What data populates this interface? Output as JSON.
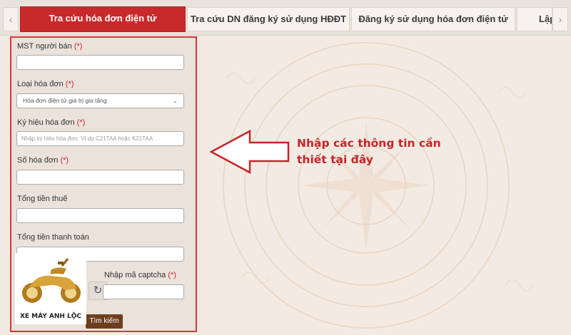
{
  "tabs": [
    {
      "label": "Tra cứu hóa đơn điện tử",
      "active": true
    },
    {
      "label": "Tra cứu DN đăng ký sử dụng HĐĐT",
      "active": false
    },
    {
      "label": "Đăng ký sử dụng hóa đơn điện tử",
      "active": false
    },
    {
      "label": "Lập",
      "active": false
    }
  ],
  "nav": {
    "prev_icon": "chevron-left-icon",
    "next_icon": "chevron-right-icon",
    "prev_glyph": "‹",
    "next_glyph": "›"
  },
  "form": {
    "mst_label": "MST người bán",
    "required_mark": "(*)",
    "invoice_type_label": "Loại hóa đơn",
    "invoice_type_value": "Hóa đơn điện tử giá trị gia tăng",
    "symbol_label": "Ký hiệu hóa đơn",
    "symbol_placeholder": "Nhập ký hiệu hóa đơn. Ví dụ C21TAA hoặc K21TAA",
    "number_label": "Số hóa đơn",
    "tax_total_label": "Tổng tiền thuế",
    "payment_total_label": "Tổng tiền thanh toán",
    "captcha_label": "Nhập mã captcha",
    "search_button": "Tìm kiếm"
  },
  "annotation": {
    "line1": "Nhập các thông tin cần",
    "line2": "thiết tại đây"
  },
  "logo": {
    "text": "XE MÁY ANH LỘC"
  },
  "colors": {
    "accent": "#c8292b",
    "annotation": "#c4252a",
    "panel_border": "#d8353a",
    "button": "#6d3e1e"
  }
}
